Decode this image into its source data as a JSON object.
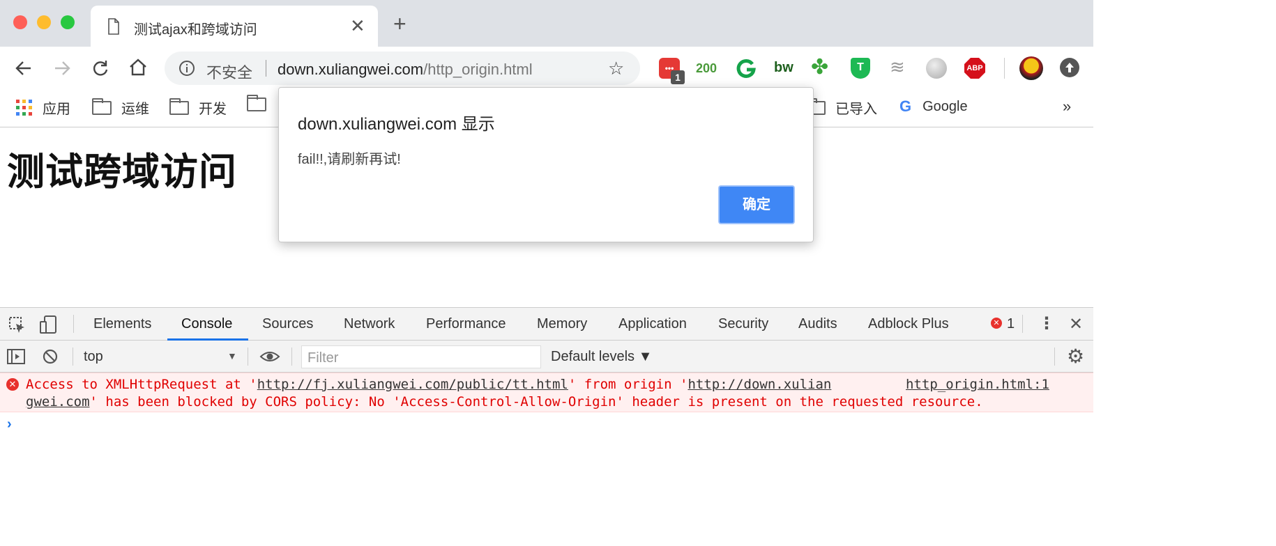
{
  "tab": {
    "title": "测试ajax和跨域访问",
    "close": "✕",
    "new_tab": "+"
  },
  "omnibox": {
    "security_label": "不安全",
    "url_host": "down.xuliangwei.com",
    "url_path": "/http_origin.html"
  },
  "extensions": {
    "badge_count": "1",
    "counter_200": "200",
    "bw_label": "bw",
    "abp_label": "ABP"
  },
  "bookmarks": {
    "apps": "应用",
    "items": [
      "运维",
      "开发"
    ],
    "imported": "已导入",
    "google": "Google",
    "overflow": "»"
  },
  "page": {
    "heading": "测试跨域访问"
  },
  "dialog": {
    "title": "down.xuliangwei.com 显示",
    "message": "fail!!,请刷新再试!",
    "ok_label": "确定"
  },
  "devtools": {
    "tabs": [
      "Elements",
      "Console",
      "Sources",
      "Network",
      "Performance",
      "Memory",
      "Application",
      "Security",
      "Audits",
      "Adblock Plus"
    ],
    "active_tab": "Console",
    "error_count": "1",
    "context": "top",
    "filter_placeholder": "Filter",
    "levels": "Default levels ▼",
    "error": {
      "line1_a": "Access to XMLHttpRequest at '",
      "url1": "http://fj.xuliangwei.com/public/tt.html",
      "line1_b": "' from origin '",
      "url2_part1": "http://down.xulian",
      "source": "http_origin.html:1",
      "url2_part2": "gwei.com",
      "line2": "' has been blocked by CORS policy: No 'Access-Control-Allow-Origin' header is present on the requested resource."
    },
    "prompt": "›"
  }
}
